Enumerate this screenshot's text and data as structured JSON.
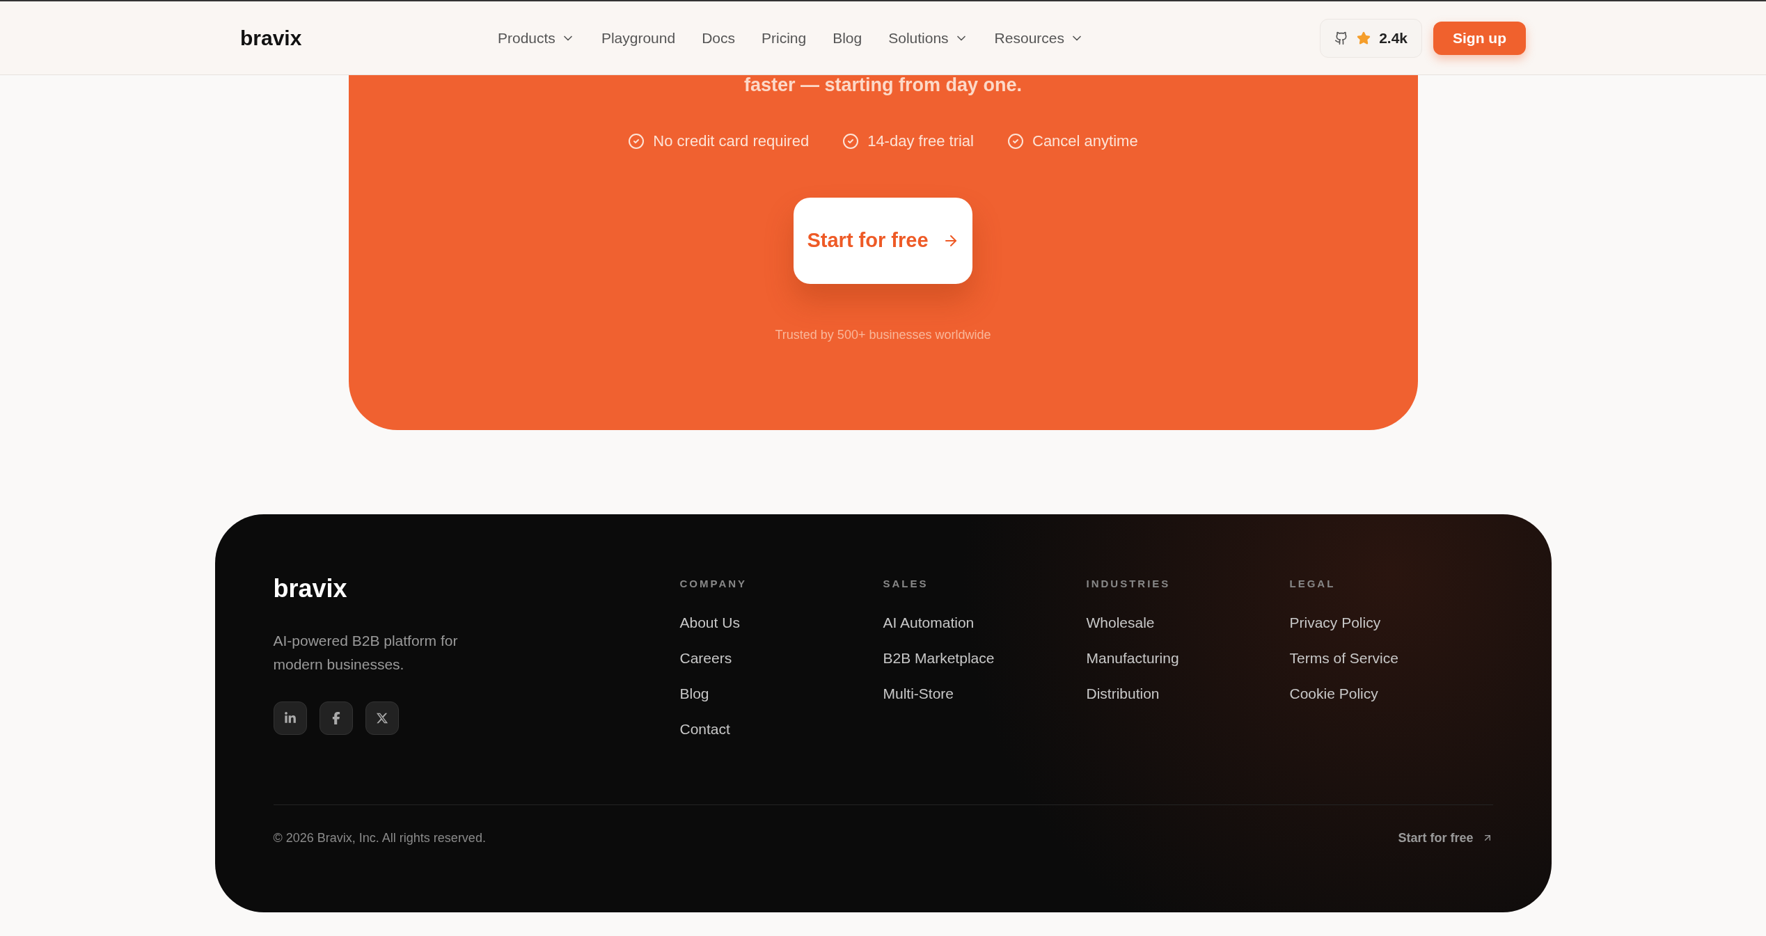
{
  "header": {
    "logo": "bravix",
    "nav": [
      {
        "label": "Products",
        "dropdown": true
      },
      {
        "label": "Playground",
        "dropdown": false
      },
      {
        "label": "Docs",
        "dropdown": false
      },
      {
        "label": "Pricing",
        "dropdown": false
      },
      {
        "label": "Blog",
        "dropdown": false
      },
      {
        "label": "Solutions",
        "dropdown": true
      },
      {
        "label": "Resources",
        "dropdown": true
      }
    ],
    "github_stars": "2.4k",
    "signup": "Sign up"
  },
  "cta": {
    "headline": "faster — starting from day one.",
    "perks": [
      "No credit card required",
      "14-day free trial",
      "Cancel anytime"
    ],
    "button": "Start for free",
    "note": "Trusted by 500+ businesses worldwide"
  },
  "footer": {
    "logo": "bravix",
    "description": "AI-powered B2B platform for modern businesses.",
    "columns": [
      {
        "heading": "COMPANY",
        "links": [
          "About Us",
          "Careers",
          "Blog",
          "Contact"
        ]
      },
      {
        "heading": "SALES",
        "links": [
          "AI Automation",
          "B2B Marketplace",
          "Multi-Store"
        ]
      },
      {
        "heading": "INDUSTRIES",
        "links": [
          "Wholesale",
          "Manufacturing",
          "Distribution"
        ]
      },
      {
        "heading": "LEGAL",
        "links": [
          "Privacy Policy",
          "Terms of Service",
          "Cookie Policy"
        ]
      }
    ],
    "copyright": "© 2026 Bravix, Inc. All rights reserved.",
    "bottom_link": "Start for free"
  }
}
